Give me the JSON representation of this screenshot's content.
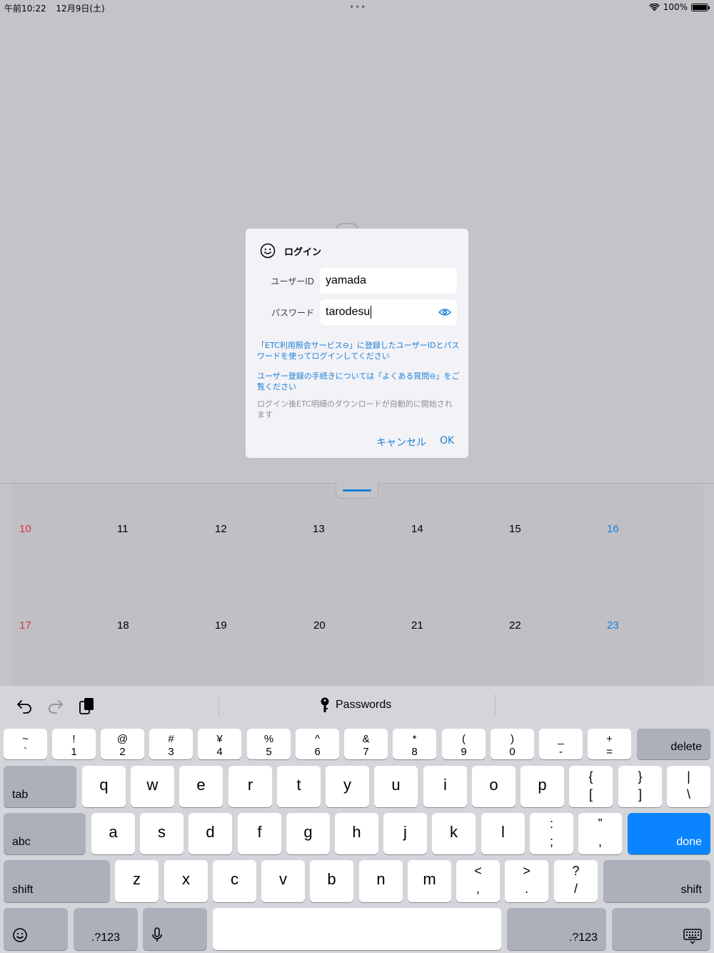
{
  "status_bar": {
    "time": "午前10:22",
    "date": "12月9日(土)",
    "dots": "•••",
    "battery": "100%"
  },
  "dialog": {
    "title": "ログイン",
    "user_id_label": "ユーザーID",
    "user_id_value": "yamada",
    "password_label": "パスワード",
    "password_value": "tarodesu",
    "note1": "「ETC利用照会サービス⊖」に登録したユーザーIDとパスワードを使ってログインしてください",
    "note2": "ユーザー登録の手続きについては「よくある質問⊖」をご覧ください",
    "note3": "ログイン後ETC明細のダウンロードが自動的に開始されます",
    "cancel": "キャンセル",
    "ok": "OK"
  },
  "calendar": {
    "week1": [
      "10",
      "11",
      "12",
      "13",
      "14",
      "15",
      "16"
    ],
    "week2": [
      "17",
      "18",
      "19",
      "20",
      "21",
      "22",
      "23"
    ]
  },
  "keyboard": {
    "passwords_label": "Passwords",
    "number_row": [
      {
        "top": "~",
        "bot": "`"
      },
      {
        "top": "!",
        "bot": "1"
      },
      {
        "top": "@",
        "bot": "2"
      },
      {
        "top": "#",
        "bot": "3"
      },
      {
        "top": "¥",
        "bot": "4"
      },
      {
        "top": "%",
        "bot": "5"
      },
      {
        "top": "^",
        "bot": "6"
      },
      {
        "top": "&",
        "bot": "7"
      },
      {
        "top": "*",
        "bot": "8"
      },
      {
        "top": "(",
        "bot": "9"
      },
      {
        "top": ")",
        "bot": "0"
      },
      {
        "top": "_",
        "bot": "-"
      },
      {
        "top": "+",
        "bot": "="
      }
    ],
    "delete": "delete",
    "tab": "tab",
    "row_q": [
      "q",
      "w",
      "e",
      "r",
      "t",
      "y",
      "u",
      "i",
      "o",
      "p"
    ],
    "row_q_extra": [
      {
        "top": "{",
        "bot": "["
      },
      {
        "top": "}",
        "bot": "]"
      },
      {
        "top": "|",
        "bot": "\\"
      }
    ],
    "abc": "abc",
    "row_a": [
      "a",
      "s",
      "d",
      "f",
      "g",
      "h",
      "j",
      "k",
      "l"
    ],
    "row_a_extra": [
      {
        "top": ":",
        "bot": ";"
      },
      {
        "top": "”",
        "bot": ","
      }
    ],
    "done": "done",
    "shift": "shift",
    "row_z": [
      "z",
      "x",
      "c",
      "v",
      "b",
      "n",
      "m"
    ],
    "row_z_extra": [
      {
        "top": "<",
        "bot": ","
      },
      {
        "top": ">",
        "bot": "."
      },
      {
        "top": "?",
        "bot": "/"
      }
    ],
    "numbers_key": ".?123"
  }
}
